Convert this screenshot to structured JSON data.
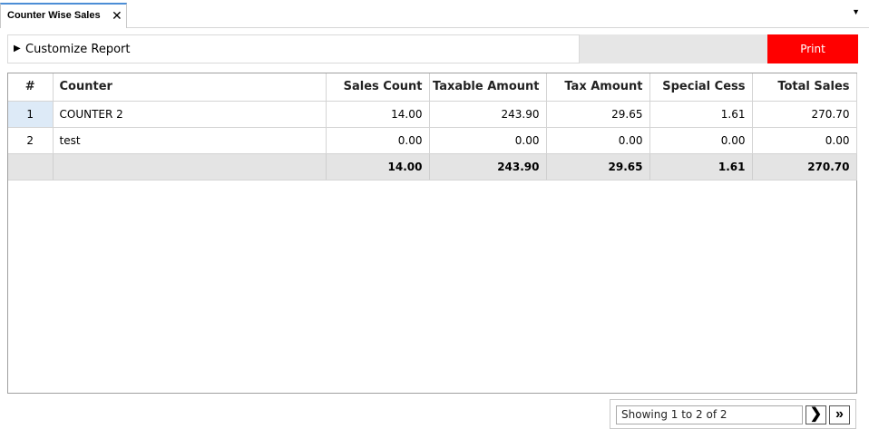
{
  "tab": {
    "title": "Counter Wise Sales",
    "close_icon": "✕",
    "menu_icon": "▼"
  },
  "toolbar": {
    "customize_icon": "▶",
    "customize_label": "Customize Report",
    "print_label": "Print",
    "print_color": "#ff0000"
  },
  "table": {
    "columns": [
      "#",
      "Counter",
      "Sales Count",
      "Taxable Amount",
      "Tax Amount",
      "Special Cess",
      "Total Sales"
    ],
    "rows": [
      [
        "1",
        "COUNTER 2",
        "14.00",
        "243.90",
        "29.65",
        "1.61",
        "270.70"
      ],
      [
        "2",
        "test",
        "0.00",
        "0.00",
        "0.00",
        "0.00",
        "0.00"
      ]
    ],
    "totals": [
      "",
      "",
      "14.00",
      "243.90",
      "29.65",
      "1.61",
      "270.70"
    ]
  },
  "pager": {
    "status": "Showing 1 to 2 of 2",
    "next_icon": "❯",
    "last_icon": "»"
  }
}
